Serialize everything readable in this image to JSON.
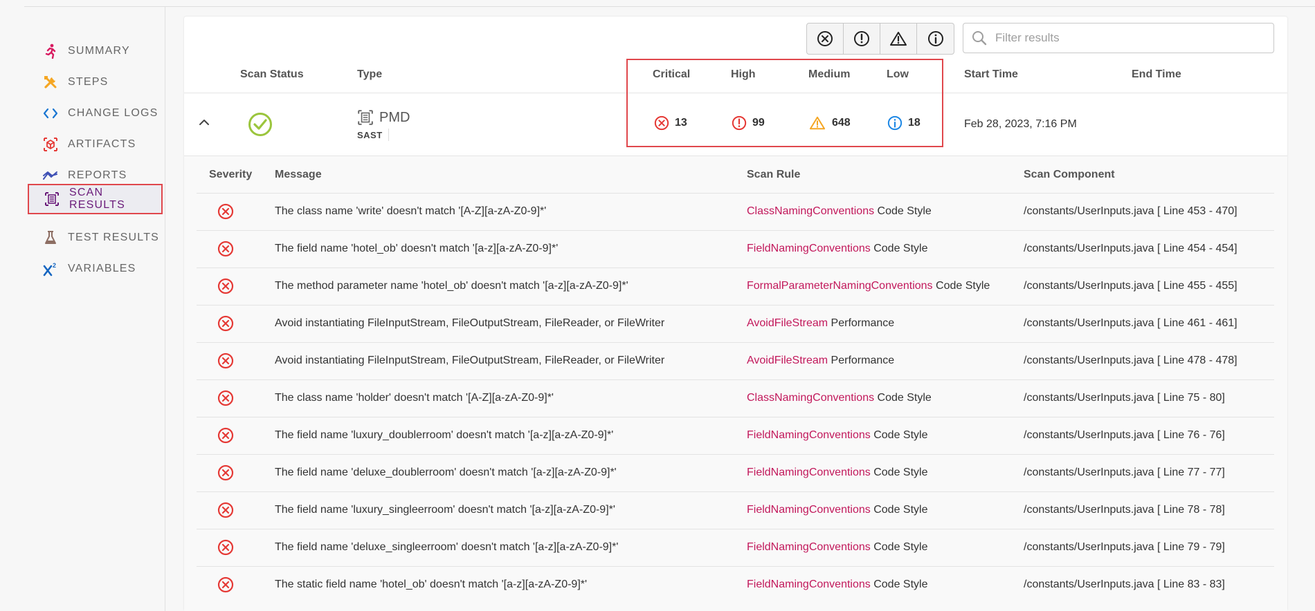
{
  "sidebar": {
    "items": [
      {
        "label": "SUMMARY",
        "icon": "running-person-icon",
        "color": "#d81b60"
      },
      {
        "label": "STEPS",
        "icon": "tools-icon",
        "color": "#f5a623"
      },
      {
        "label": "CHANGE LOGS",
        "icon": "code-brackets-icon",
        "color": "#1976d2"
      },
      {
        "label": "ARTIFACTS",
        "icon": "package-icon",
        "color": "#e53935"
      },
      {
        "label": "REPORTS",
        "icon": "trend-chart-icon",
        "color": "#3f51b5"
      },
      {
        "label": "SCAN RESULTS",
        "icon": "scan-document-icon",
        "color": "#6a1b7a",
        "active": true
      },
      {
        "label": "TEST RESULTS",
        "icon": "flask-icon",
        "color": "#8d6e63"
      },
      {
        "label": "VARIABLES",
        "icon": "x-squared-icon",
        "color": "#1565c0"
      }
    ]
  },
  "toolbar": {
    "filters": [
      "critical-filter-icon",
      "high-filter-icon",
      "medium-filter-icon",
      "low-filter-icon"
    ],
    "search_placeholder": "Filter results"
  },
  "scan_table": {
    "headers": {
      "scan_status": "Scan Status",
      "type": "Type",
      "critical": "Critical",
      "high": "High",
      "medium": "Medium",
      "low": "Low",
      "start_time": "Start Time",
      "end_time": "End Time"
    },
    "row": {
      "status": "success",
      "type_name": "PMD",
      "type_category": "SAST",
      "critical": "13",
      "high": "99",
      "medium": "648",
      "low": "18",
      "start_time": "Feb 28, 2023, 7:16 PM",
      "end_time": ""
    }
  },
  "results": {
    "headers": {
      "severity": "Severity",
      "message": "Message",
      "scan_rule": "Scan Rule",
      "scan_component": "Scan Component"
    },
    "rows": [
      {
        "severity": "critical",
        "message": "The class name 'write' doesn't match '[A-Z][a-zA-Z0-9]*'",
        "rule": "ClassNamingConventions",
        "category": "Code Style",
        "component": "/constants/UserInputs.java [ Line 453 - 470]"
      },
      {
        "severity": "critical",
        "message": "The field name 'hotel_ob' doesn't match '[a-z][a-zA-Z0-9]*'",
        "rule": "FieldNamingConventions",
        "category": "Code Style",
        "component": "/constants/UserInputs.java [ Line 454 - 454]"
      },
      {
        "severity": "critical",
        "message": "The method parameter name 'hotel_ob' doesn't match '[a-z][a-zA-Z0-9]*'",
        "rule": "FormalParameterNamingConventions",
        "category": "Code Style",
        "component": "/constants/UserInputs.java [ Line 455 - 455]"
      },
      {
        "severity": "critical",
        "message": "Avoid instantiating FileInputStream, FileOutputStream, FileReader, or FileWriter",
        "rule": "AvoidFileStream",
        "category": "Performance",
        "component": "/constants/UserInputs.java [ Line 461 - 461]"
      },
      {
        "severity": "critical",
        "message": "Avoid instantiating FileInputStream, FileOutputStream, FileReader, or FileWriter",
        "rule": "AvoidFileStream",
        "category": "Performance",
        "component": "/constants/UserInputs.java [ Line 478 - 478]"
      },
      {
        "severity": "critical",
        "message": "The class name 'holder' doesn't match '[A-Z][a-zA-Z0-9]*'",
        "rule": "ClassNamingConventions",
        "category": "Code Style",
        "component": "/constants/UserInputs.java [ Line 75 - 80]"
      },
      {
        "severity": "critical",
        "message": "The field name 'luxury_doublerroom' doesn't match '[a-z][a-zA-Z0-9]*'",
        "rule": "FieldNamingConventions",
        "category": "Code Style",
        "component": "/constants/UserInputs.java [ Line 76 - 76]"
      },
      {
        "severity": "critical",
        "message": "The field name 'deluxe_doublerroom' doesn't match '[a-z][a-zA-Z0-9]*'",
        "rule": "FieldNamingConventions",
        "category": "Code Style",
        "component": "/constants/UserInputs.java [ Line 77 - 77]"
      },
      {
        "severity": "critical",
        "message": "The field name 'luxury_singleerroom' doesn't match '[a-z][a-zA-Z0-9]*'",
        "rule": "FieldNamingConventions",
        "category": "Code Style",
        "component": "/constants/UserInputs.java [ Line 78 - 78]"
      },
      {
        "severity": "critical",
        "message": "The field name 'deluxe_singleerroom' doesn't match '[a-z][a-zA-Z0-9]*'",
        "rule": "FieldNamingConventions",
        "category": "Code Style",
        "component": "/constants/UserInputs.java [ Line 79 - 79]"
      },
      {
        "severity": "critical",
        "message": "The static field name 'hotel_ob' doesn't match '[a-z][a-zA-Z0-9]*'",
        "rule": "FieldNamingConventions",
        "category": "Code Style",
        "component": "/constants/UserInputs.java [ Line 83 - 83]"
      }
    ]
  },
  "colors": {
    "critical": "#e53935",
    "high": "#e53935",
    "medium": "#f5a623",
    "low": "#1e88e5",
    "success": "#9bc53d",
    "rule_link": "#c2185b",
    "highlight_box": "#e0474c"
  }
}
